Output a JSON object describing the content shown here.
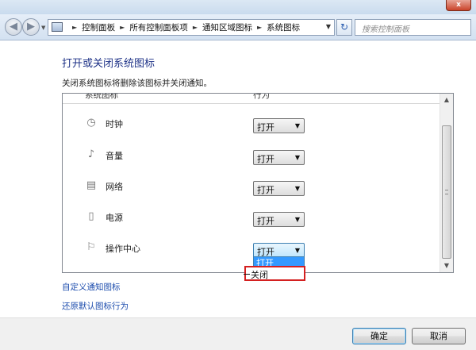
{
  "window": {
    "close_glyph": "x"
  },
  "address_bar": {
    "crumbs": [
      "控制面板",
      "所有控制面板项",
      "通知区域图标",
      "系统图标"
    ],
    "search_placeholder": "搜索控制面板"
  },
  "page": {
    "title": "打开或关闭系统图标",
    "description": "关闭系统图标将删除该图标并关闭通知。"
  },
  "list": {
    "col_icon": "系统图标",
    "col_behavior": "行为",
    "rows": [
      {
        "label": "时钟",
        "value": "打开",
        "icon": "clock-icon"
      },
      {
        "label": "音量",
        "value": "打开",
        "icon": "volume-icon"
      },
      {
        "label": "网络",
        "value": "打开",
        "icon": "network-icon"
      },
      {
        "label": "电源",
        "value": "打开",
        "icon": "power-icon"
      },
      {
        "label": "操作中心",
        "value": "打开",
        "icon": "flag-icon"
      }
    ],
    "dropdown_options": [
      "打开",
      "关闭"
    ]
  },
  "links": {
    "customize": "自定义通知图标",
    "restore": "还原默认图标行为"
  },
  "footer": {
    "ok": "确定",
    "cancel": "取消"
  },
  "colors": {
    "title_blue": "#1e3287",
    "link_blue": "#1c4cad",
    "selection_blue": "#3399ff",
    "highlight_red": "#d42020"
  }
}
